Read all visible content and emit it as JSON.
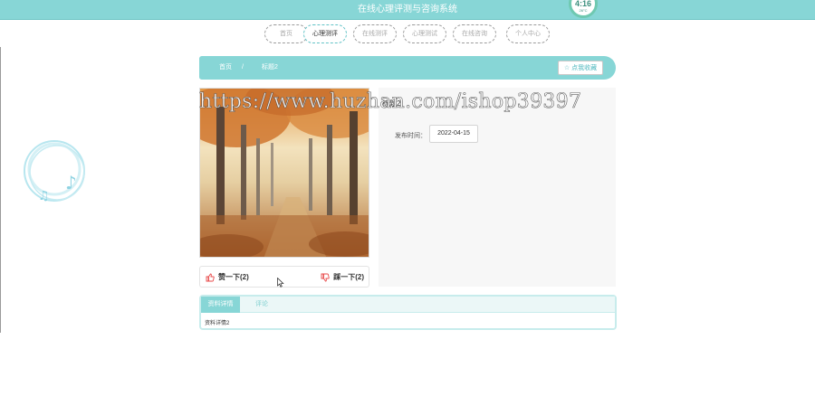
{
  "header": {
    "title": "在线心理评测与咨询系统",
    "clock": {
      "time": "4:16",
      "temperature": "26°C"
    }
  },
  "nav": {
    "tabs": [
      {
        "label": "首页",
        "active": false
      },
      {
        "label": "心理测评",
        "active": true
      },
      {
        "label": "在线测评",
        "active": false
      },
      {
        "label": "心理测试",
        "active": false
      },
      {
        "label": "在线咨询",
        "active": false
      },
      {
        "label": "个人中心",
        "active": false
      }
    ]
  },
  "breadcrumb": {
    "home": "首页",
    "separator": "/",
    "current": "标题2",
    "collect_label": "☆ 点我收藏"
  },
  "detail": {
    "title": "标题2",
    "date_label": "发布时间：",
    "date_value": "2022-04-15"
  },
  "reactions": {
    "like_label": "赞一下(2)",
    "dislike_label": "踩一下(2)"
  },
  "tabs": {
    "detail_label": "资料详情",
    "comment_label": "评论",
    "content": "资料详情2"
  },
  "watermark": "https://www.huzhan.com/ishop39397",
  "colors": {
    "accent": "#87d6d6",
    "accent_border": "#63c3c7",
    "like_icon": "#e84a4a"
  }
}
